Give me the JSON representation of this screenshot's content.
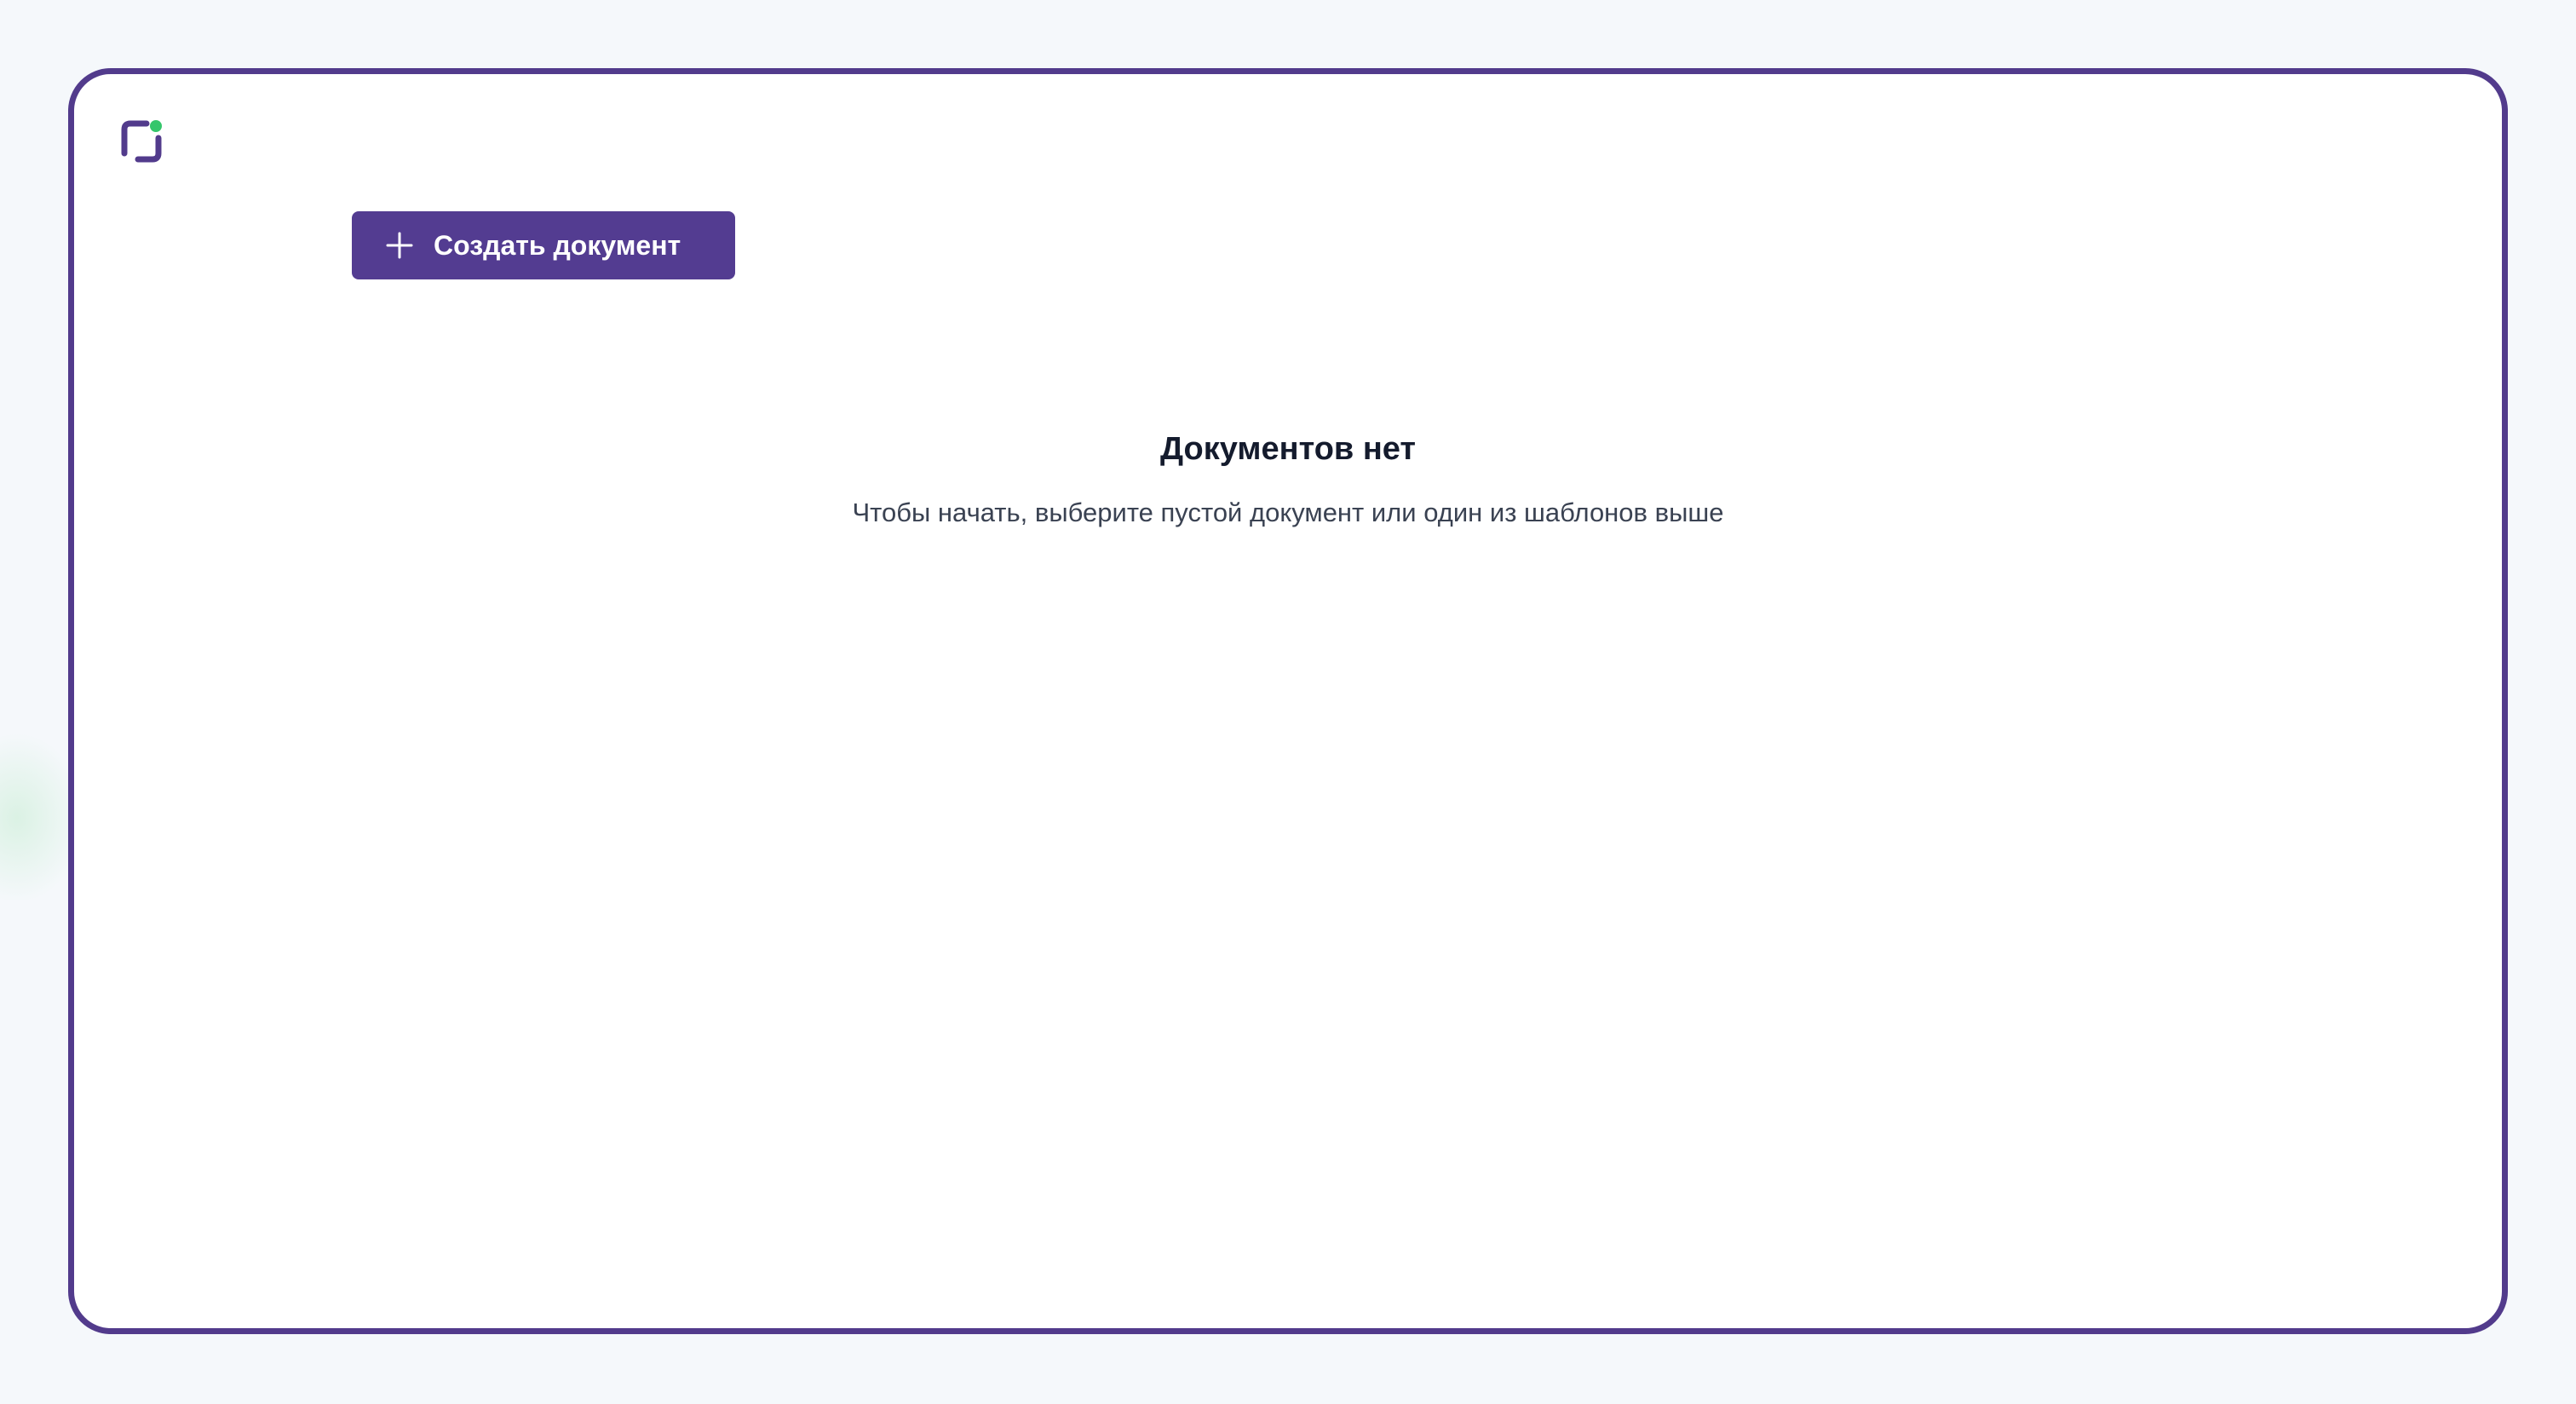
{
  "colors": {
    "brand_purple": "#523b8c",
    "button_purple": "#533c91",
    "logo_dot_green": "#35c66b",
    "title_text": "#141b2d",
    "subtitle_text": "#3a4252",
    "page_background": "#f5f8fb"
  },
  "icons": {
    "logo": "app-logo-icon",
    "create": "plus-icon"
  },
  "toolbar": {
    "create_document_label": "Создать документ"
  },
  "empty_state": {
    "title": "Документов нет",
    "subtitle": "Чтобы начать, выберите пустой документ или один из шаблонов выше"
  }
}
